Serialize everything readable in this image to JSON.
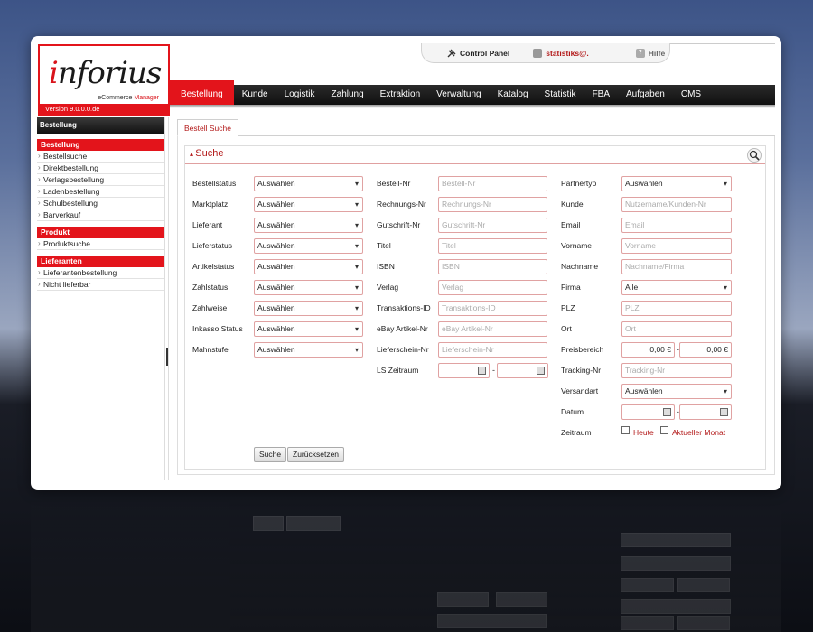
{
  "logo": {
    "wordmark": "inforius",
    "tagline_prefix": "eCommerce ",
    "tagline_accent": "Manager",
    "version": "Version 9.0.0.0.de"
  },
  "topbar": {
    "control_panel": "Control Panel",
    "user": "statistiks@.",
    "help": "Hilfe"
  },
  "nav": [
    "Bestellung",
    "Kunde",
    "Logistik",
    "Zahlung",
    "Extraktion",
    "Verwaltung",
    "Katalog",
    "Statistik",
    "FBA",
    "Aufgaben",
    "CMS"
  ],
  "sidebar": {
    "header": "Bestellung",
    "sections": [
      {
        "title": "Bestellung",
        "items": [
          "Bestellsuche",
          "Direktbestellung",
          "Verlagsbestellung",
          "Ladenbestellung",
          "Schulbestellung",
          "Barverkauf"
        ]
      },
      {
        "title": "Produkt",
        "items": [
          "Produktsuche"
        ]
      },
      {
        "title": "Lieferanten",
        "items": [
          "Lieferantenbestellung",
          "Nicht lieferbar"
        ]
      }
    ]
  },
  "subtab": "Bestell Suche",
  "search": {
    "title": "Suche",
    "col1": [
      {
        "label": "Bestellstatus",
        "value": "Auswählen"
      },
      {
        "label": "Marktplatz",
        "value": "Auswählen"
      },
      {
        "label": "Lieferant",
        "value": "Auswählen"
      },
      {
        "label": "Lieferstatus",
        "value": "Auswählen"
      },
      {
        "label": "Artikelstatus",
        "value": "Auswählen"
      },
      {
        "label": "Zahlstatus",
        "value": "Auswählen"
      },
      {
        "label": "Zahlweise",
        "value": "Auswählen"
      },
      {
        "label": "Inkasso Status",
        "value": "Auswählen"
      },
      {
        "label": "Mahnstufe",
        "value": "Auswählen"
      }
    ],
    "col2": [
      {
        "label": "Bestell-Nr",
        "placeholder": "Bestell-Nr"
      },
      {
        "label": "Rechnungs-Nr",
        "placeholder": "Rechnungs-Nr"
      },
      {
        "label": "Gutschrift-Nr",
        "placeholder": "Gutschrift-Nr"
      },
      {
        "label": "Titel",
        "placeholder": "Titel"
      },
      {
        "label": "ISBN",
        "placeholder": "ISBN"
      },
      {
        "label": "Verlag",
        "placeholder": "Verlag"
      },
      {
        "label": "Transaktions-ID",
        "placeholder": "Transaktions-ID"
      },
      {
        "label": "eBay Artikel-Nr",
        "placeholder": "eBay Artikel-Nr"
      },
      {
        "label": "Lieferschein-Nr",
        "placeholder": "Lieferschein-Nr"
      }
    ],
    "ls_zeitraum_label": "LS Zeitraum",
    "col3": {
      "partnertyp": {
        "label": "Partnertyp",
        "value": "Auswählen"
      },
      "kunde": {
        "label": "Kunde",
        "placeholder": "Nutzername/Kunden-Nr"
      },
      "email": {
        "label": "Email",
        "placeholder": "Email"
      },
      "vorname": {
        "label": "Vorname",
        "placeholder": "Vorname"
      },
      "nachname": {
        "label": "Nachname",
        "placeholder": "Nachname/Firma"
      },
      "firma": {
        "label": "Firma",
        "value": "Alle"
      },
      "plz": {
        "label": "PLZ",
        "placeholder": "PLZ"
      },
      "ort": {
        "label": "Ort",
        "placeholder": "Ort"
      },
      "preisbereich": {
        "label": "Preisbereich",
        "from": "0,00 €",
        "to": "0,00 €"
      },
      "tracking": {
        "label": "Tracking-Nr",
        "placeholder": "Tracking-Nr"
      },
      "versandart": {
        "label": "Versandart",
        "value": "Auswählen"
      },
      "datum": {
        "label": "Datum"
      },
      "zeitraum": {
        "label": "Zeitraum",
        "opt1": "Heute",
        "opt2": "Aktueller Monat"
      }
    },
    "range_sep": "-",
    "buttons": {
      "search": "Suche",
      "reset": "Zurücksetzen"
    }
  }
}
